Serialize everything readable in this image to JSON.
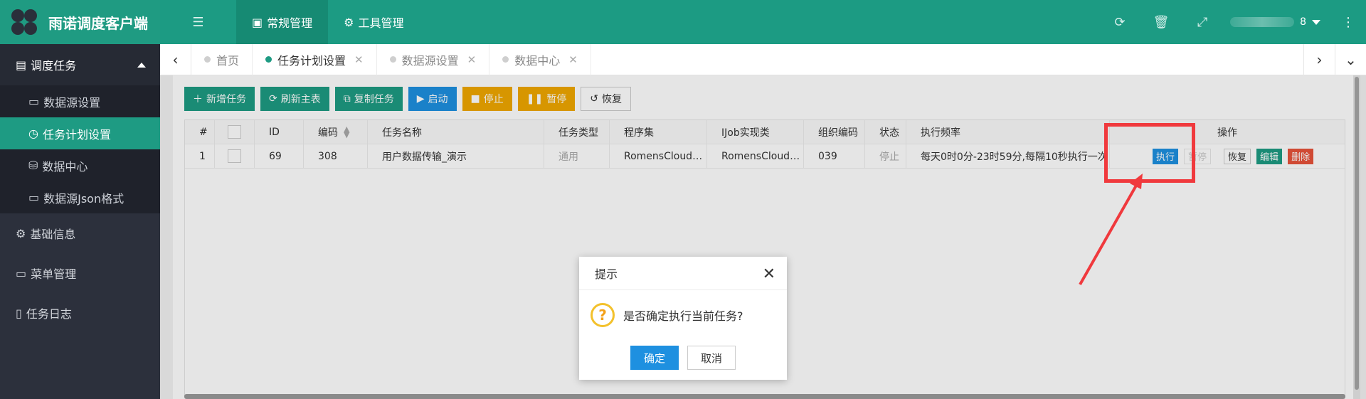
{
  "app": {
    "title": "雨诺调度客户端"
  },
  "header": {
    "menu_icon": "hamburger-icon",
    "tabs": [
      {
        "label": "常规管理",
        "icon": "id-card-icon",
        "active": true
      },
      {
        "label": "工具管理",
        "icon": "gear-icon",
        "active": false
      }
    ],
    "right_icons": [
      "refresh-icon",
      "trash-icon",
      "fullscreen-icon",
      "more-icon"
    ],
    "user_suffix": "8"
  },
  "sidebar": {
    "groups": [
      {
        "label": "调度任务",
        "icon": "server-icon",
        "expanded": true,
        "items": [
          {
            "label": "数据源设置",
            "icon": "list-icon",
            "active": false
          },
          {
            "label": "任务计划设置",
            "icon": "clock-icon",
            "active": true
          },
          {
            "label": "数据中心",
            "icon": "database-icon",
            "active": false
          },
          {
            "label": "数据源Json格式",
            "icon": "list-icon",
            "active": false
          }
        ]
      },
      {
        "label": "基础信息",
        "icon": "gear-icon",
        "expanded": false
      },
      {
        "label": "菜单管理",
        "icon": "window-icon"
      },
      {
        "label": "任务日志",
        "icon": "file-icon"
      }
    ]
  },
  "pagetabs": [
    {
      "label": "首页",
      "closable": false,
      "active": false
    },
    {
      "label": "任务计划设置",
      "closable": true,
      "active": true
    },
    {
      "label": "数据源设置",
      "closable": true,
      "active": false
    },
    {
      "label": "数据中心",
      "closable": true,
      "active": false
    }
  ],
  "toolbar": {
    "add": "新增任务",
    "refresh": "刷新主表",
    "copy": "复制任务",
    "start": "启动",
    "stop": "停止",
    "pause": "暂停",
    "resume": "恢复"
  },
  "table": {
    "headers": [
      "#",
      "",
      "ID",
      "编码",
      "任务名称",
      "任务类型",
      "程序集",
      "IJob实现类",
      "组织编码",
      "状态",
      "执行频率",
      "操作"
    ],
    "rows": [
      {
        "index": "1",
        "id": "69",
        "code": "308",
        "name": "用户数据传输_演示",
        "type": "通用",
        "assembly": "RomensCloud…",
        "impl": "RomensCloud…",
        "org": "039",
        "status": "停止",
        "frequency": "每天0时0分-23时59分,每隔10秒执行一次",
        "actions": {
          "execute": "执行",
          "pause": "暂停",
          "resume": "恢复",
          "edit": "编辑",
          "delete": "删除"
        }
      }
    ]
  },
  "dialog": {
    "title": "提示",
    "message": "是否确定执行当前任务?",
    "confirm": "确定",
    "cancel": "取消",
    "icon": "question-icon"
  },
  "colors": {
    "primary": "#1e9b83",
    "sidebar": "#2c303c",
    "blue": "#1e90e0",
    "orange": "#f0a800",
    "red": "#e8533a",
    "annotation": "#f0393d"
  }
}
